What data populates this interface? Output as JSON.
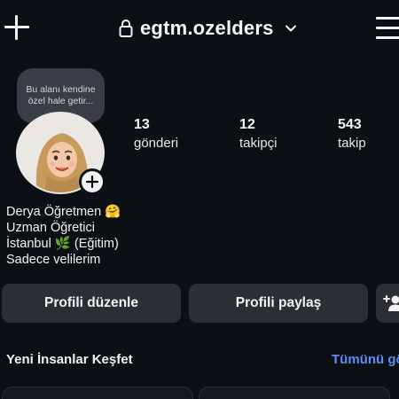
{
  "header": {
    "username": "egtm.ozelders",
    "icons": {
      "new_post": "plus-icon",
      "privacy": "lock-icon",
      "switch_account": "chevron-down-icon",
      "menu": "hamburger-menu-icon"
    }
  },
  "note": {
    "text": "Bu alanı kendine özel hale getir..."
  },
  "profile": {
    "avatar": "avatar-illustration-hijab",
    "stats": [
      {
        "value": "13",
        "label": "gönderi"
      },
      {
        "value": "12",
        "label": "takipçi"
      },
      {
        "value": "543",
        "label": "takip"
      }
    ],
    "bio": {
      "line1": "Derya Öğretmen 🤗",
      "line2": "Uzman Öğretici",
      "line3": "İstanbul 🌿 (Eğitim)",
      "line4": "Sadece velilerim"
    }
  },
  "actions": {
    "edit_profile": "Profili düzenle",
    "share_profile": "Profili paylaş",
    "add_user_icon": "add-user-icon"
  },
  "discover": {
    "title": "Yeni İnsanlar Keşfet",
    "see_all": "Tümünü gör"
  },
  "colors": {
    "background": "#0c0f14",
    "button": "#2b2e33",
    "link": "#5b8ff5",
    "note_bubble": "#3a3d43"
  }
}
